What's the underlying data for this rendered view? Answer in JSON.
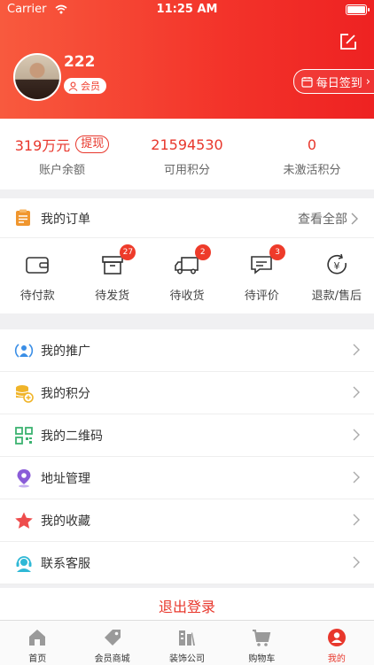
{
  "status_bar": {
    "carrier": "Carrier",
    "time": "11:25 AM"
  },
  "profile": {
    "username": "222",
    "member_label": "会员",
    "signin_label": "每日签到"
  },
  "stats": [
    {
      "value": "319万元",
      "action": "提现",
      "label": "账户余额"
    },
    {
      "value": "21594530",
      "label": "可用积分"
    },
    {
      "value": "0",
      "label": "未激活积分"
    }
  ],
  "orders": {
    "title": "我的订单",
    "view_all": "查看全部",
    "items": [
      {
        "label": "待付款",
        "badge": ""
      },
      {
        "label": "待发货",
        "badge": "27"
      },
      {
        "label": "待收货",
        "badge": "2"
      },
      {
        "label": "待评价",
        "badge": "3"
      },
      {
        "label": "退款/售后",
        "badge": ""
      }
    ]
  },
  "menu": [
    {
      "label": "我的推广",
      "icon": "broadcast-icon"
    },
    {
      "label": "我的积分",
      "icon": "coins-icon"
    },
    {
      "label": "我的二维码",
      "icon": "qrcode-icon"
    },
    {
      "label": "地址管理",
      "icon": "location-pin-icon"
    },
    {
      "label": "我的收藏",
      "icon": "star-icon"
    },
    {
      "label": "联系客服",
      "icon": "customer-service-icon"
    }
  ],
  "logout_label": "退出登录",
  "tabs": [
    {
      "label": "首页",
      "icon": "home-icon"
    },
    {
      "label": "会员商城",
      "icon": "tag-icon"
    },
    {
      "label": "装饰公司",
      "icon": "building-icon"
    },
    {
      "label": "购物车",
      "icon": "cart-icon"
    },
    {
      "label": "我的",
      "icon": "user-icon",
      "active": true
    }
  ],
  "colors": {
    "accent": "#e8372c",
    "header_start": "#f85a3e",
    "header_end": "#ee2222"
  }
}
